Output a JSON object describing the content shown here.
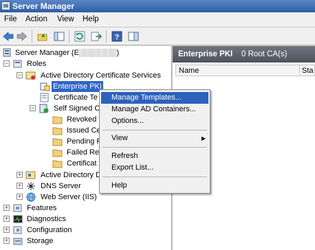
{
  "window": {
    "title": "Server Manager"
  },
  "menu": [
    "File",
    "Action",
    "View",
    "Help"
  ],
  "toolbar": {
    "icons": [
      "back-arrow-icon",
      "forward-arrow-icon",
      "up-folder-icon",
      "show-hide-tree-icon",
      "refresh-icon",
      "export-list-icon",
      "help-icon",
      "action-pane-icon"
    ]
  },
  "tree": {
    "root": "Server Manager (E░░░░░░░)",
    "roles": "Roles",
    "adcs": "Active Directory Certificate Services",
    "enterprise_pki": "Enterprise PKI",
    "cert_templates": "Certificate Te",
    "self_signed": "Self Signed C",
    "revoked": "Revoked",
    "issued": "Issued Ce",
    "pending": "Pending F",
    "failed": "Failed Re",
    "certificate": "Certificat",
    "ad_domain": "Active Directory D",
    "dns": "DNS Server",
    "web": "Web Server (IIS)",
    "features": "Features",
    "diagnostics": "Diagnostics",
    "configuration": "Configuration",
    "storage": "Storage"
  },
  "right_pane": {
    "title": "Enterprise PKI",
    "count": "0 Root CA(s)",
    "columns": [
      "Name",
      "Sta"
    ]
  },
  "context_menu": {
    "items": {
      "manage_templates": "Manage Templates...",
      "manage_ad": "Manage AD Containers...",
      "options": "Options...",
      "view": "View",
      "refresh": "Refresh",
      "export": "Export List...",
      "help": "Help"
    },
    "submenu_arrow": "▶"
  }
}
